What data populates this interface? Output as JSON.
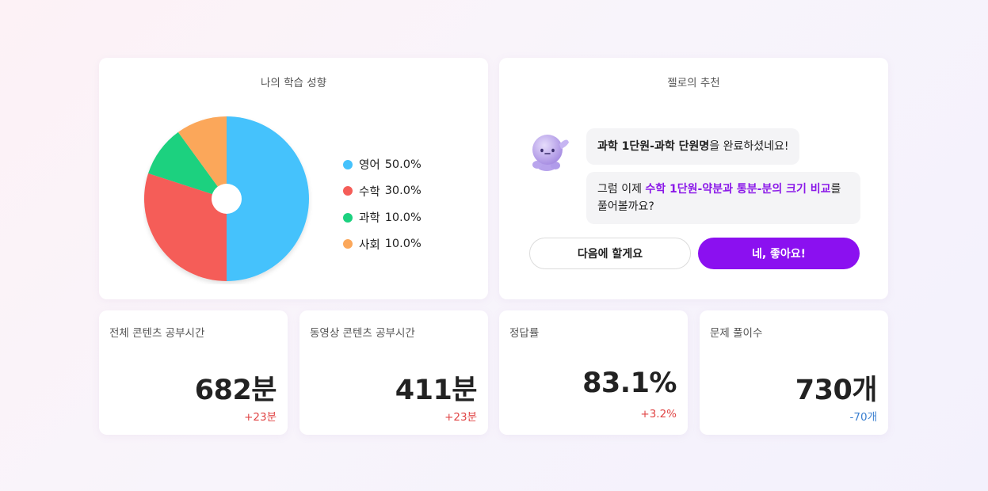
{
  "tendency": {
    "title": "나의 학습 성향",
    "legend": [
      {
        "name": "영어",
        "pct": "50.0%",
        "color": "#45c2fc"
      },
      {
        "name": "수학",
        "pct": "30.0%",
        "color": "#f55d58"
      },
      {
        "name": "과학",
        "pct": "10.0%",
        "color": "#1bd17f"
      },
      {
        "name": "사회",
        "pct": "10.0%",
        "color": "#fba75a"
      }
    ]
  },
  "chart_data": {
    "type": "pie",
    "categories": [
      "영어",
      "수학",
      "과학",
      "사회"
    ],
    "values": [
      50.0,
      30.0,
      10.0,
      10.0
    ],
    "colors": [
      "#45c2fc",
      "#f55d58",
      "#1bd17f",
      "#fba75a"
    ],
    "title": "나의 학습 성향",
    "legend": "right"
  },
  "reco": {
    "title": "젤로의 추천",
    "msg1": {
      "strong": "과학 1단원-과학 단원명",
      "rest": "을 완료하셨네요!"
    },
    "msg2": {
      "pre": "그럼 이제 ",
      "highlight": "수학 1단원-약분과 통분-분의 크기 비교",
      "post": "를 풀어볼까요?"
    },
    "btn_later": "다음에 할게요",
    "btn_yes": "네, 좋아요!",
    "accent": "#8b10f0"
  },
  "stats": [
    {
      "label": "전체 콘텐츠 공부시간",
      "value": "682분",
      "delta": "+23분",
      "delta_color": "#e04444"
    },
    {
      "label": "동영상 콘텐츠 공부시간",
      "value": "411분",
      "delta": "+23분",
      "delta_color": "#e04444"
    },
    {
      "label": "정답률",
      "value": "83.1%",
      "delta": "+3.2%",
      "delta_color": "#e04444"
    },
    {
      "label": "문제 풀이수",
      "value": "730개",
      "delta": "-70개",
      "delta_color": "#3a7fd0"
    }
  ]
}
